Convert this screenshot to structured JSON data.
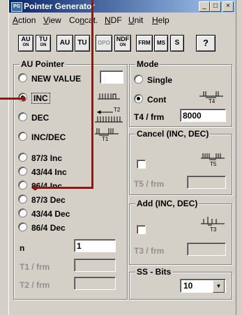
{
  "window": {
    "title": "Pointer Generator",
    "title_icon": "app-icon"
  },
  "title_buttons": {
    "minimize": "_",
    "maximize": "□",
    "close": "×"
  },
  "menu": [
    {
      "label": "Action",
      "accel": "A",
      "rest": "ction"
    },
    {
      "label": "View",
      "accel": "V",
      "rest": "iew"
    },
    {
      "label": "Concat.",
      "pre": "Co",
      "accel": "n",
      "rest": "cat."
    },
    {
      "label": "NDF",
      "pre": "",
      "accel": "N",
      "rest": "DF"
    },
    {
      "label": "Unit",
      "accel": "U",
      "rest": "nit"
    },
    {
      "label": "Help",
      "accel": "H",
      "rest": "elp"
    }
  ],
  "toolbar": {
    "au_on": {
      "main": "AU",
      "sub": "ON"
    },
    "tu_on": {
      "main": "TU",
      "sub": "ON"
    },
    "au": "AU",
    "tu": "TU",
    "dpo": "DPO",
    "ndf_on": {
      "main": "NDF",
      "sub": "ON"
    },
    "frm": "FRM",
    "ms": "MS",
    "s": "S",
    "help": "?"
  },
  "au_pointer": {
    "title": "AU Pointer",
    "options": [
      {
        "label": "NEW VALUE",
        "checked": false,
        "enabled": true
      },
      {
        "label": "INC",
        "checked": true,
        "enabled": true
      },
      {
        "label": "DEC",
        "checked": false,
        "enabled": true
      },
      {
        "label": "INC/DEC",
        "checked": false,
        "enabled": true
      },
      {
        "label": "87/3  Inc",
        "checked": false,
        "enabled": true
      },
      {
        "label": "43/44 Inc",
        "checked": false,
        "enabled": true
      },
      {
        "label": "86/4  Inc",
        "checked": false,
        "enabled": true
      },
      {
        "label": "87/3  Dec",
        "checked": false,
        "enabled": true
      },
      {
        "label": "43/44 Dec",
        "checked": false,
        "enabled": true
      },
      {
        "label": "86/4  Dec",
        "checked": false,
        "enabled": true
      }
    ],
    "new_value_field": "",
    "n_label": "n",
    "n_value": "1",
    "t1_label": "T1 / frm",
    "t1_value": "",
    "t2_label": "T2 / frm",
    "t2_value": "",
    "t2_symbol": "T2",
    "t1_symbol": "T1"
  },
  "mode": {
    "title": "Mode",
    "single": "Single",
    "cont": "Cont",
    "selected": "Cont",
    "t4_label": "T4 / frm",
    "t4_value": "8000",
    "t4_symbol": "T4"
  },
  "cancel": {
    "title": "Cancel (INC, DEC)",
    "t5_label": "T5 / frm",
    "t5_value": "",
    "t5_symbol": "T5"
  },
  "add": {
    "title": "Add (INC, DEC)",
    "t3_label": "T3 / frm",
    "t3_value": "",
    "t3_symbol": "T3"
  },
  "ss_bits": {
    "title": "SS - Bits",
    "value": "10"
  },
  "colors": {
    "callout": "#8b1a10",
    "titlebar": "#0a246a"
  }
}
